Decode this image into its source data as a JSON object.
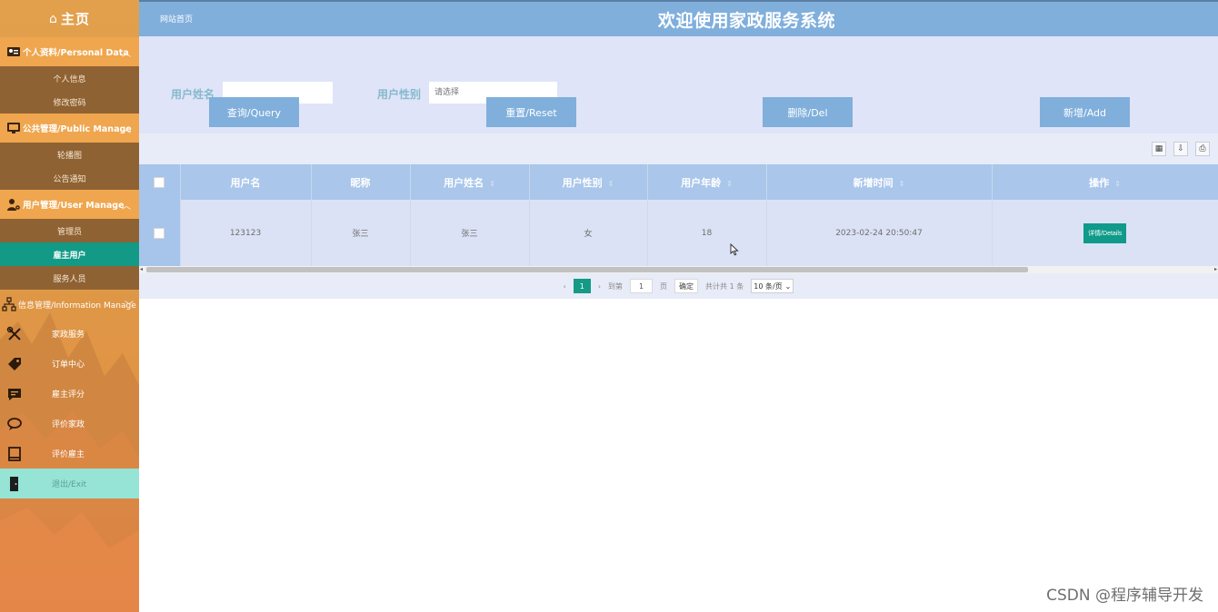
{
  "sidebar": {
    "home": "主页",
    "groups": [
      {
        "label": "个人资料/Personal Data",
        "items": [
          "个人信息",
          "修改密码"
        ]
      },
      {
        "label": "公共管理/Public Manage",
        "items": [
          "轮播图",
          "公告通知"
        ]
      },
      {
        "label": "用户管理/User Manage",
        "items": [
          "管理员",
          "雇主用户",
          "服务人员"
        ]
      },
      {
        "label": "信息管理/Information Manage",
        "items": [
          "家政服务",
          "订单中心",
          "雇主评分",
          "评价家政",
          "评价雇主"
        ]
      }
    ],
    "exit": "退出/Exit"
  },
  "header": {
    "site_link": "网站首页",
    "title": "欢迎使用家政服务系统"
  },
  "search": {
    "name_label": "用户姓名",
    "name_value": "",
    "gender_label": "用户性别",
    "gender_placeholder": "请选择"
  },
  "buttons": {
    "query": "查询/Query",
    "reset": "重置/Reset",
    "delete": "删除/Del",
    "add": "新增/Add"
  },
  "table": {
    "columns": [
      "用户名",
      "昵称",
      "用户姓名",
      "用户性别",
      "用户年龄",
      "新增时间",
      "操作"
    ],
    "rows": [
      {
        "username": "123123",
        "nickname": "张三",
        "realname": "张三",
        "gender": "女",
        "age": "18",
        "created": "2023-02-24 20:50:47",
        "action": "详情/Details"
      }
    ]
  },
  "pager": {
    "current": "1",
    "goto_prefix": "到第",
    "goto_value": "1",
    "goto_suffix": "页",
    "confirm": "确定",
    "total": "共计共 1 条",
    "page_size": "10 条/页"
  },
  "watermark": "CSDN @程序辅导开发"
}
